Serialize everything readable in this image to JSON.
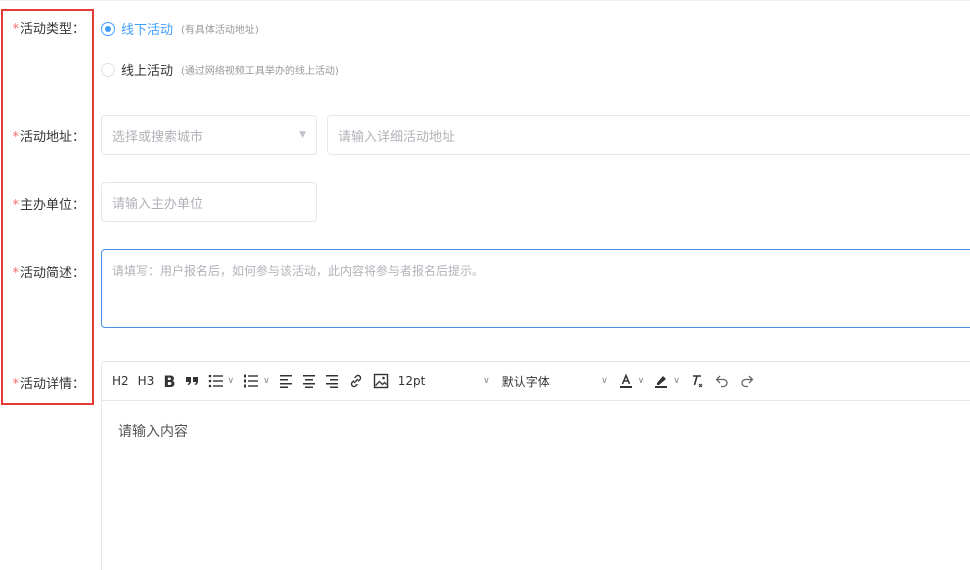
{
  "form": {
    "activity_type": {
      "label": "活动类型：",
      "options": [
        {
          "label": "线下活动",
          "hint": "(有具体活动地址)",
          "checked": true
        },
        {
          "label": "线上活动",
          "hint": "(通过网络视频工具举办的线上活动)",
          "checked": false
        }
      ]
    },
    "address": {
      "label": "活动地址：",
      "city_placeholder": "选择或搜索城市",
      "detail_placeholder": "请输入详细活动地址"
    },
    "organizer": {
      "label": "主办单位：",
      "placeholder": "请输入主办单位"
    },
    "summary": {
      "label": "活动简述：",
      "placeholder": "请填写：用户报名后，如何参与该活动，此内容将参与者报名后提示。"
    },
    "details": {
      "label": "活动详情：",
      "toolbar": {
        "h2": "H2",
        "h3": "H3",
        "bold": "B",
        "font_size": "12pt",
        "font_family": "默认字体"
      },
      "placeholder": "请输入内容"
    }
  },
  "colors": {
    "required": "#f56c6c",
    "accent": "#409eff",
    "highlight_box": "#e53935"
  },
  "icons": [
    "quote-icon",
    "bullet-list-icon",
    "numbered-list-icon",
    "align-left-icon",
    "align-center-icon",
    "align-right-icon",
    "link-icon",
    "image-icon",
    "font-color-icon",
    "highlight-icon",
    "clear-format-icon",
    "undo-icon",
    "redo-icon"
  ]
}
